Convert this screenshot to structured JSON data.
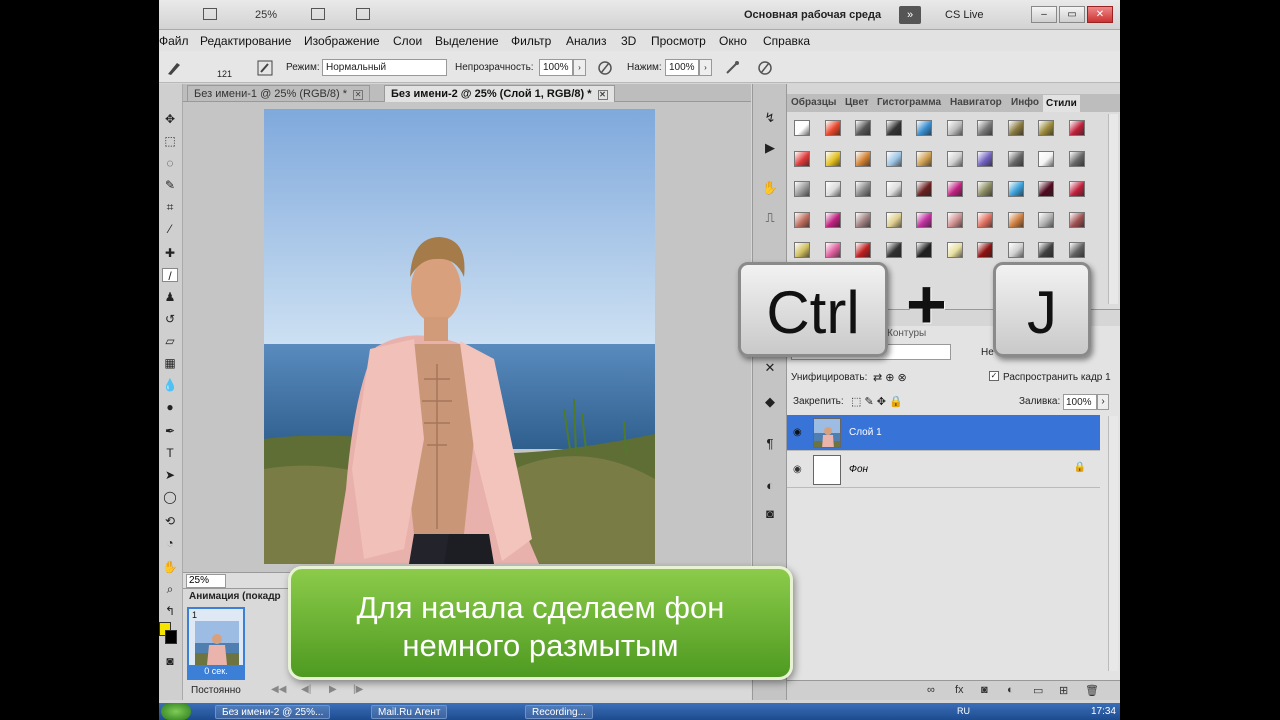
{
  "topbar": {
    "zoom": "25%",
    "workspace": "Основная рабочая среда",
    "workspace_more": "»",
    "cs_live": "CS Live"
  },
  "window_controls": {
    "minimize": "–",
    "restore": "▭",
    "close": "✕"
  },
  "menu": [
    "Файл",
    "Редактирование",
    "Изображение",
    "Слои",
    "Выделение",
    "Фильтр",
    "Анализ",
    "3D",
    "Просмотр",
    "Окно",
    "Справка"
  ],
  "options": {
    "brush_size": "121",
    "mode_label": "Режим:",
    "mode_value": "Нормальный",
    "opacity_label": "Непрозрачность:",
    "opacity_value": "100%",
    "pressure_label": "Нажим:",
    "pressure_value": "100%"
  },
  "tabs": [
    {
      "label": "Без имени-1 @ 25% (RGB/8) *",
      "close": "✕"
    },
    {
      "label": "Без имени-2 @ 25% (Слой 1, RGB/8) *",
      "close": "✕"
    }
  ],
  "doc_zoom": "25%",
  "animation": {
    "title": "Анимация (покадр",
    "frame_number": "1",
    "frame_delay": "0 сек.",
    "loop": "Постоянно"
  },
  "panel_tabs": [
    "Образцы",
    "Цвет",
    "Гистограмма",
    "Навигатор",
    "Инфо",
    "Стили"
  ],
  "layers_panel": {
    "paths_tab": "Контуры",
    "opacity_short": "Не",
    "unify_label": "Унифицировать:",
    "propagate_label": "Распространить кадр 1",
    "lock_label": "Закрепить:",
    "fill_label": "Заливка:",
    "fill_value": "100%",
    "layers": [
      {
        "name": "Слой 1",
        "selected": true
      },
      {
        "name": "Фон",
        "selected": false
      }
    ]
  },
  "overlay": {
    "key1": "Ctrl",
    "plus": "+",
    "key2": "J",
    "caption_line1": "Для начала сделаем фон",
    "caption_line2": "немного размытым"
  },
  "taskbar": {
    "items": [
      "Без имени-2 @ 25%...",
      "Mail.Ru Агент",
      "Recording..."
    ],
    "lang": "RU",
    "clock": "17:34"
  },
  "colors": {
    "selection_blue": "#3874d8",
    "banner_green": "#6bb536",
    "foreground_swatch": "#f5e400",
    "background_swatch": "#000000"
  }
}
